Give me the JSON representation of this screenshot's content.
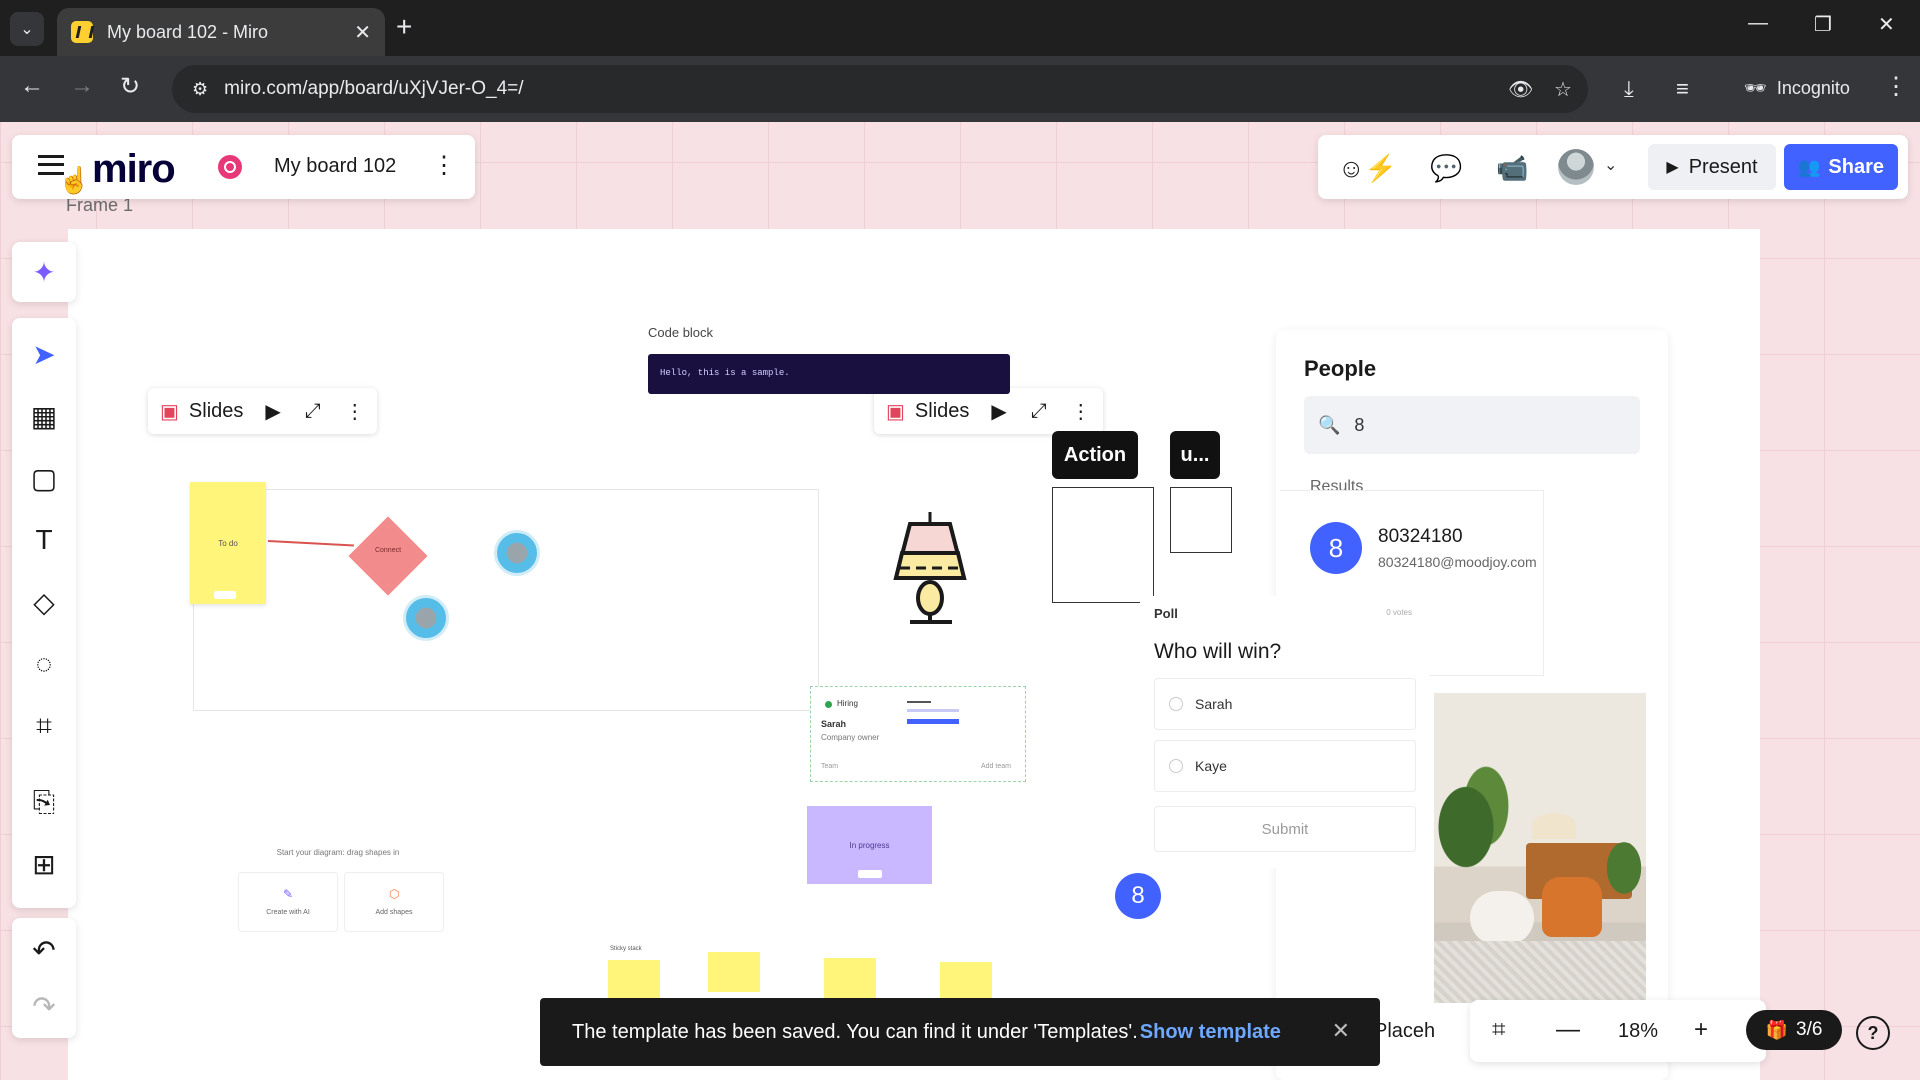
{
  "browser": {
    "tab_title": "My board 102 - Miro",
    "url": "miro.com/app/board/uXjVJer-O_4=/",
    "incognito_label": "Incognito"
  },
  "header": {
    "logo": "miro",
    "board_name": "My board 102"
  },
  "top_right": {
    "present_label": "Present",
    "share_label": "Share"
  },
  "board": {
    "frame_label": "Frame 1",
    "slides_label": "Slides",
    "code_block_label": "Code block",
    "code_text": "Hello, this is a sample.",
    "action_tag": "Action",
    "u_tag": "u...",
    "profile": {
      "status": "Hiring",
      "name": "Sarah",
      "role": "Company owner",
      "team": "Team",
      "add_team": "Add team"
    },
    "purple_card": "In progress",
    "diagram_hint": "Start your diagram: drag shapes in",
    "hint_ai": "Create with AI",
    "hint_shapes": "Add shapes",
    "sticky_label": "To do",
    "diamond_label": "Connect",
    "sticky_stack_label": "Sticky stack"
  },
  "people_panel": {
    "title": "People",
    "search_value": "8",
    "results_label": "Results",
    "result": {
      "avatar_letter": "8",
      "name": "80324180",
      "email": "80324180@moodjoy.com"
    }
  },
  "poll": {
    "header": "Poll",
    "votes": "0 votes",
    "question": "Who will win?",
    "options": [
      "Sarah",
      "Kaye"
    ],
    "submit_label": "Submit"
  },
  "user_badge": "8",
  "toast": {
    "message": "The template has been saved. You can find it under 'Templates'.",
    "link": "Show template"
  },
  "placeholder_text": "Placeh",
  "zoom": {
    "level": "18%",
    "pages": "3/6"
  },
  "colors": {
    "accent": "#4262ff",
    "board_bg": "#f7e1e4",
    "sticky": "#fff57a"
  }
}
